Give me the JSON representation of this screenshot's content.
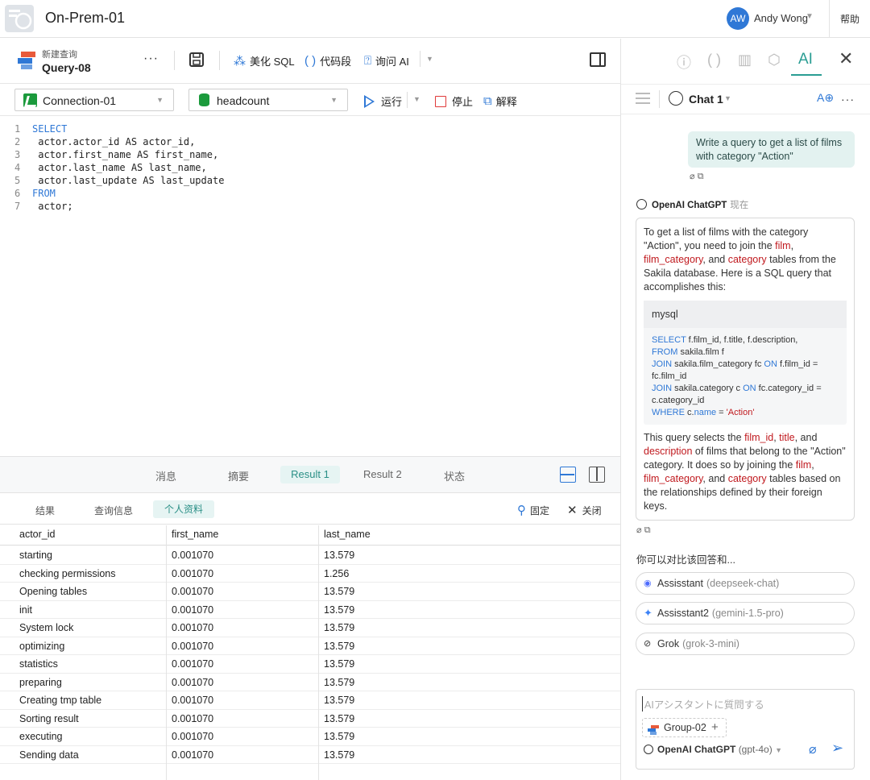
{
  "window": {
    "title": "On-Prem-01"
  },
  "user": {
    "initials": "AW",
    "name": "Andy Wong",
    "help": "帮助"
  },
  "toolbar": {
    "query_subtitle": "新建查询",
    "query_name": "Query-08",
    "more": "···",
    "beautify": "美化 SQL",
    "snippet": "代码段",
    "ask_ai": "询问 AI",
    "connection": "Connection-01",
    "database": "headcount",
    "run": "运行",
    "stop": "停止",
    "explain": "解释"
  },
  "editor": {
    "lines": [
      {
        "n": "1",
        "kw": "SELECT",
        "text": ""
      },
      {
        "n": "2",
        "kw": "",
        "text": " actor.actor_id AS actor_id,"
      },
      {
        "n": "3",
        "kw": "",
        "text": " actor.first_name AS first_name,"
      },
      {
        "n": "4",
        "kw": "",
        "text": " actor.last_name AS last_name,"
      },
      {
        "n": "5",
        "kw": "",
        "text": " actor.last_update AS last_update"
      },
      {
        "n": "6",
        "kw": "FROM",
        "text": ""
      },
      {
        "n": "7",
        "kw": "",
        "text": " actor;"
      }
    ]
  },
  "result_tabs": [
    "消息",
    "摘要",
    "Result 1",
    "Result 2",
    "状态"
  ],
  "sub_tabs": [
    "结果",
    "查询信息",
    "个人资料"
  ],
  "actions": {
    "pin": "固定",
    "close": "关闭"
  },
  "table": {
    "columns": [
      "actor_id",
      "first_name",
      "last_name"
    ],
    "rows": [
      [
        "starting",
        "0.001070",
        "13.579"
      ],
      [
        "checking permissions",
        "0.001070",
        "1.256"
      ],
      [
        "Opening tables",
        "0.001070",
        "13.579"
      ],
      [
        "init",
        "0.001070",
        "13.579"
      ],
      [
        "System lock",
        "0.001070",
        "13.579"
      ],
      [
        "optimizing",
        "0.001070",
        "13.579"
      ],
      [
        "statistics",
        "0.001070",
        "13.579"
      ],
      [
        "preparing",
        "0.001070",
        "13.579"
      ],
      [
        "Creating tmp table",
        "0.001070",
        "13.579"
      ],
      [
        "Sorting result",
        "0.001070",
        "13.579"
      ],
      [
        "executing",
        "0.001070",
        "13.579"
      ],
      [
        "Sending data",
        "0.001070",
        "13.579"
      ]
    ]
  },
  "ai": {
    "tab_label": "AI",
    "chat_title": "Chat 1",
    "user_message": "Write a query to get a list of films with category \"Action\"",
    "bot_name": "OpenAI ChatGPT",
    "bot_time": "现在",
    "bot_intro_1": "To get a list of films with the category \"Action\", you need to join the ",
    "bot_intro_film": "film",
    "bot_intro_comma": ", ",
    "bot_intro_film_category": "film_category",
    "bot_intro_and": ", and ",
    "bot_intro_category": "category",
    "bot_intro_2": " tables from the Sakila database. Here is a SQL query that accomplishes this:",
    "code_lang": "mysql",
    "code": {
      "l1_kw": "SELECT",
      "l1": " f.film_id, f.title, f.description,",
      "l2_kw": "FROM",
      "l2": " sakila.film f",
      "l3_kw": "JOIN",
      "l3a": " sakila.film_category fc ",
      "l3_on": "ON",
      "l3b": " f.film_id =",
      "l4": "fc.film_id",
      "l5_kw": "JOIN",
      "l5a": " sakila.category c ",
      "l5_on": "ON",
      "l5b": " fc.category_id =",
      "l6": "c.category_id",
      "l7_kw": "WHERE",
      "l7a": " c.",
      "l7_name": "name",
      "l7b": " = ",
      "l7_str": "'Action'"
    },
    "bot_after_1": "This query selects the ",
    "bot_after_film_id": "film_id",
    "bot_after_c1": ", ",
    "bot_after_title": "title",
    "bot_after_c2": ", and ",
    "bot_after_description": "description",
    "bot_after_2": " of films that belong to the \"Action\" category. It does so by joining the ",
    "bot_after_film": "film",
    "bot_after_c3": ", ",
    "bot_after_film_category": "film_category",
    "bot_after_c4": ", and ",
    "bot_after_category": "category",
    "bot_after_3": " tables based on the relationships defined by their foreign keys.",
    "compare_title": "你可以对比该回答和...",
    "compare": [
      {
        "name": "Assisstant",
        "model": "(deepseek-chat)"
      },
      {
        "name": "Assisstant2",
        "model": "(gemini-1.5-pro)"
      },
      {
        "name": "Grok",
        "model": "(grok-3-mini)"
      }
    ],
    "input_placeholder": "AIアシスタントに質問する",
    "group_chip": "Group-02",
    "model_name": "OpenAI ChatGPT",
    "model_sub": "(gpt-4o)"
  },
  "colors": {
    "accent": "#2f78d6",
    "teal": "#2a9d93",
    "keyword_red": "#c0191e"
  }
}
